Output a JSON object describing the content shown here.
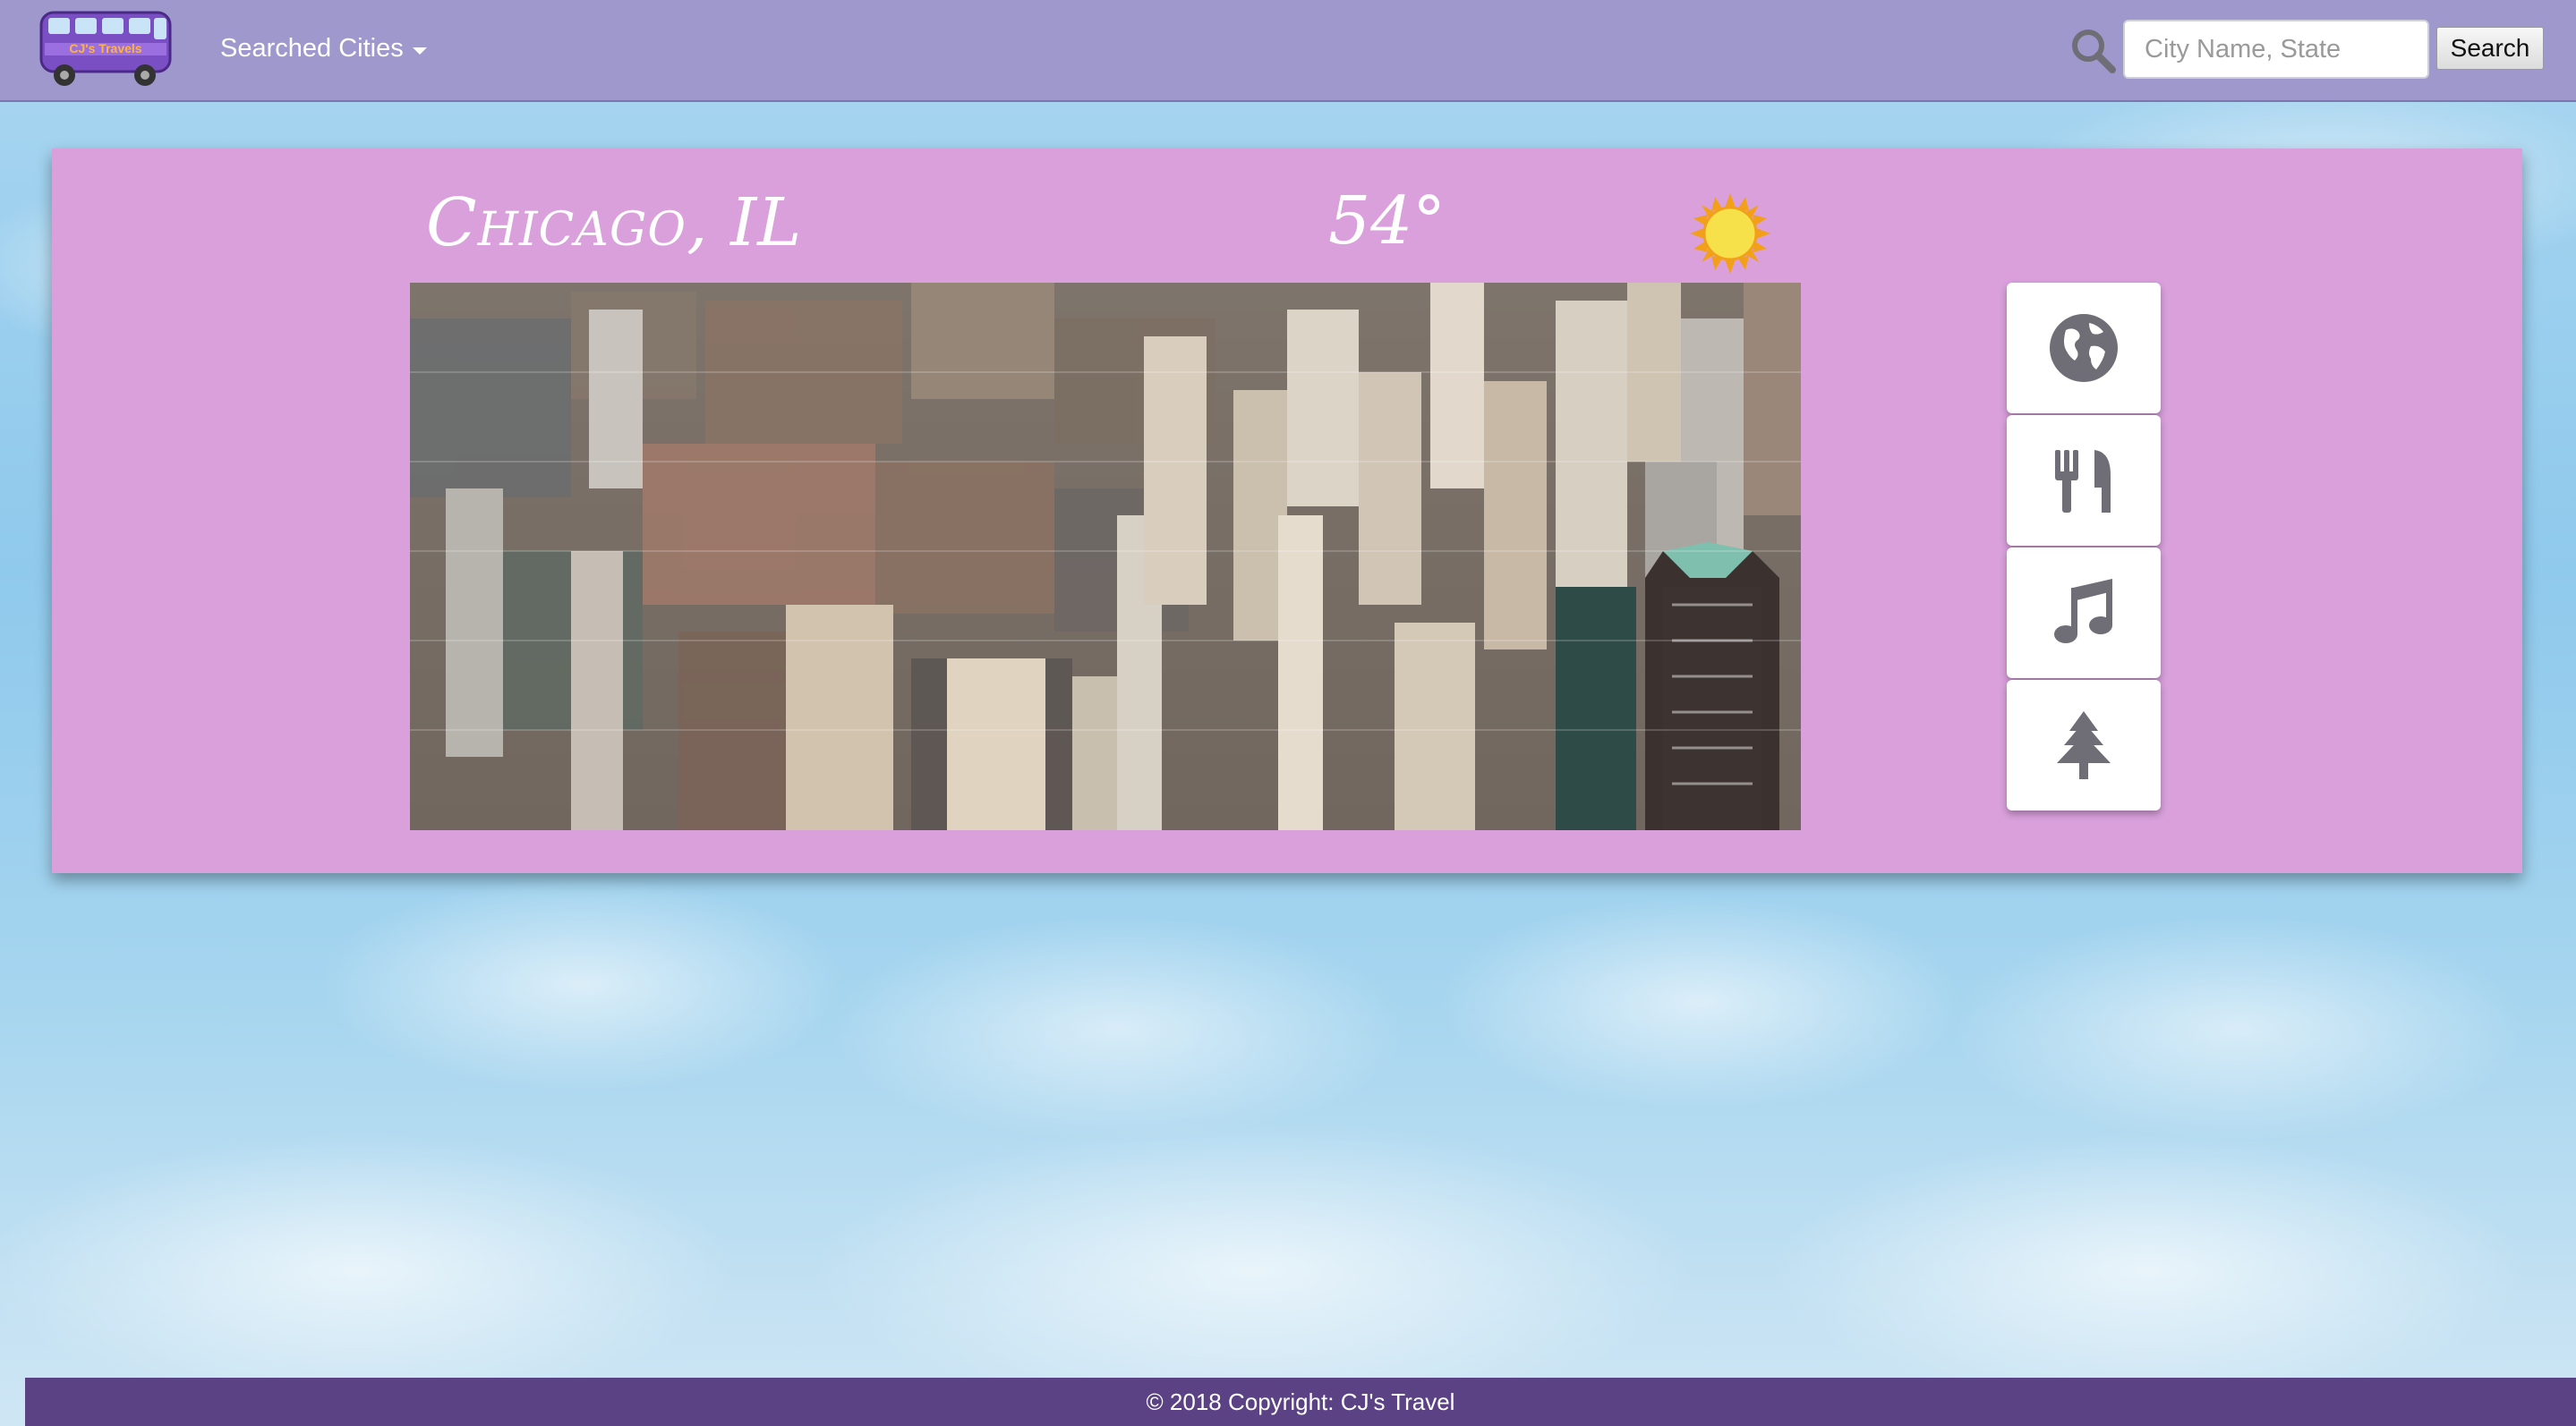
{
  "navbar": {
    "logo_text": "CJ's Travels",
    "dropdown_label": "Searched Cities",
    "search": {
      "placeholder": "City Name, State",
      "value": "",
      "button_label": "Search"
    }
  },
  "city": {
    "name": "Chicago, IL",
    "temperature": "54°",
    "weather_icon": "sun-icon",
    "photo": "chicago-skyline-aerial-photo",
    "categories": [
      {
        "name": "attractions",
        "icon": "globe-icon"
      },
      {
        "name": "restaurants",
        "icon": "fork-knife-icon"
      },
      {
        "name": "music",
        "icon": "music-note-icon"
      },
      {
        "name": "parks",
        "icon": "tree-icon"
      }
    ]
  },
  "footer": {
    "copyright": "© 2018 Copyright: CJ's Travel"
  },
  "colors": {
    "navbar": "#9f98cc",
    "card": "#d9a0dc",
    "footer": "#5b4285",
    "icon_gray": "#6f6d75"
  }
}
